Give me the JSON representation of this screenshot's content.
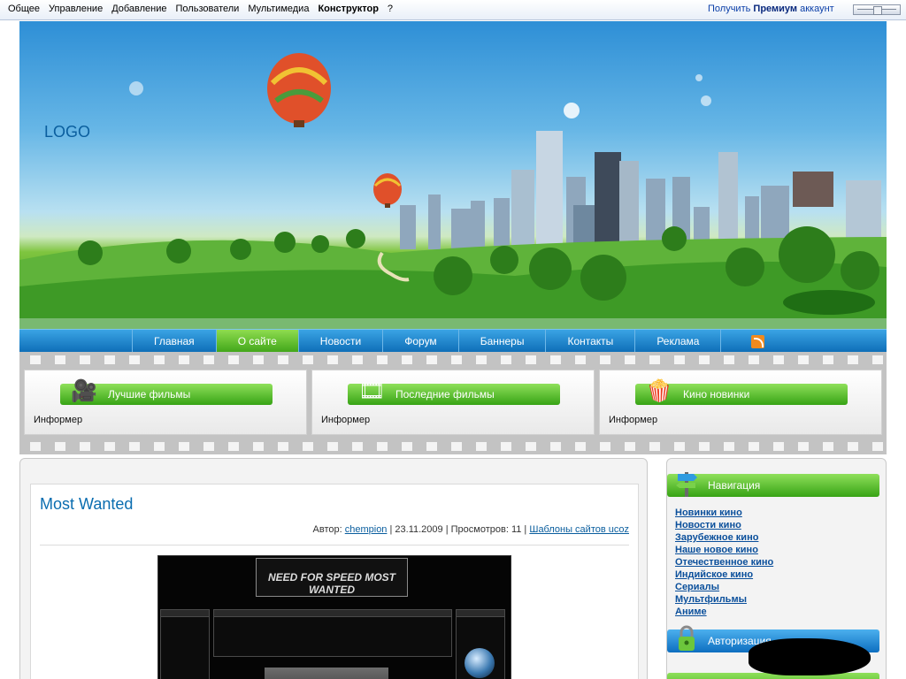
{
  "adminbar": {
    "menu": [
      "Общее",
      "Управление",
      "Добавление",
      "Пользователи",
      "Мультимедиа",
      "Конструктор",
      "?"
    ],
    "premium_prefix": "Получить",
    "premium_bold": "Премиум",
    "premium_suffix": "аккаунт"
  },
  "header": {
    "logo": "LOGO"
  },
  "nav": {
    "items": [
      "Главная",
      "О сайте",
      "Новости",
      "Форум",
      "Баннеры",
      "Контакты",
      "Реклама"
    ],
    "active_index": 1,
    "rss_icon": "rss-icon"
  },
  "informers": [
    {
      "title": "Лучшие фильмы",
      "text": "Информер",
      "icon": "film-projector-icon"
    },
    {
      "title": "Последние фильмы",
      "text": "Информер",
      "icon": "film-reels-icon"
    },
    {
      "title": "Кино новинки",
      "text": "Информер",
      "icon": "popcorn-icon"
    }
  ],
  "post": {
    "title": "Most Wanted",
    "author_label": "Автор:",
    "author": "chempion",
    "date": "| 23.11.2009 |",
    "views": "Просмотров: 11 |",
    "category": "Шаблоны сайтов ucoz",
    "image_logo_text": "NEED FOR SPEED MOST WANTED"
  },
  "sidebar": {
    "navigation_title": "Навигация",
    "links": [
      "Новинки кино",
      "Новости кино",
      "Зарубежное кино",
      "Наше новое кино",
      "Отечественное кино",
      "Индийское кино",
      "Сериалы",
      "Мультфильмы",
      "Аниме"
    ],
    "auth_title": "Авторизация"
  },
  "colors": {
    "nav_blue": "#1584cf",
    "accent_green": "#4dbb22",
    "link_blue": "#0a4f9b",
    "title_blue": "#0a6db0"
  }
}
